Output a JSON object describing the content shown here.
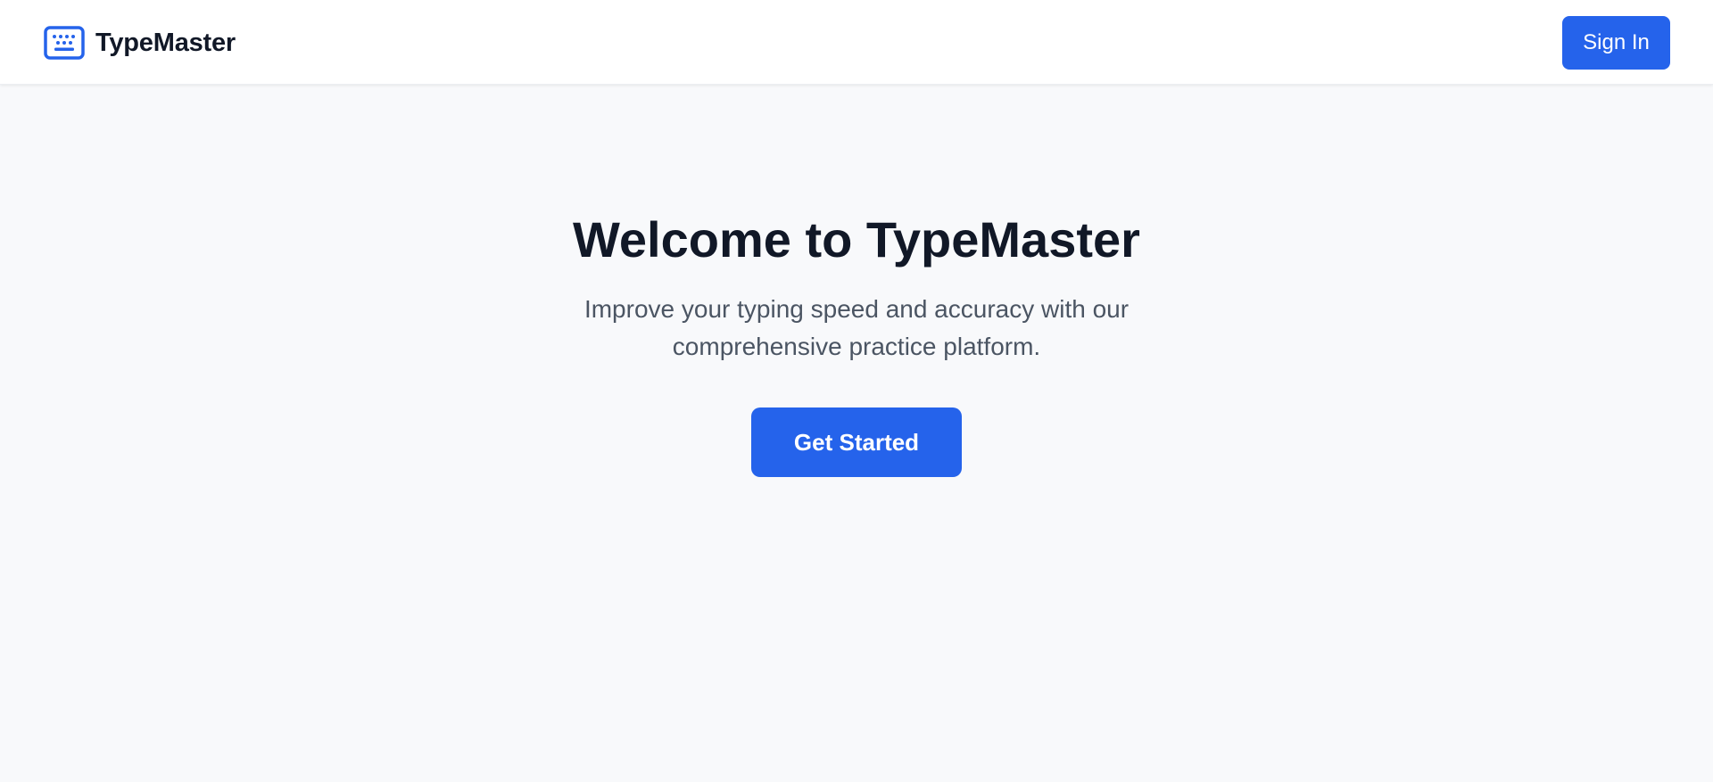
{
  "header": {
    "brand_icon": "keyboard-icon",
    "brand_name": "TypeMaster",
    "signin_label": "Sign In"
  },
  "hero": {
    "title": "Welcome to TypeMaster",
    "subtitle": "Improve your typing speed and accuracy with our comprehensive practice platform.",
    "cta_label": "Get Started"
  },
  "colors": {
    "accent": "#2563eb",
    "background": "#f8f9fb",
    "text_primary": "#111827",
    "text_secondary": "#4b5563"
  }
}
